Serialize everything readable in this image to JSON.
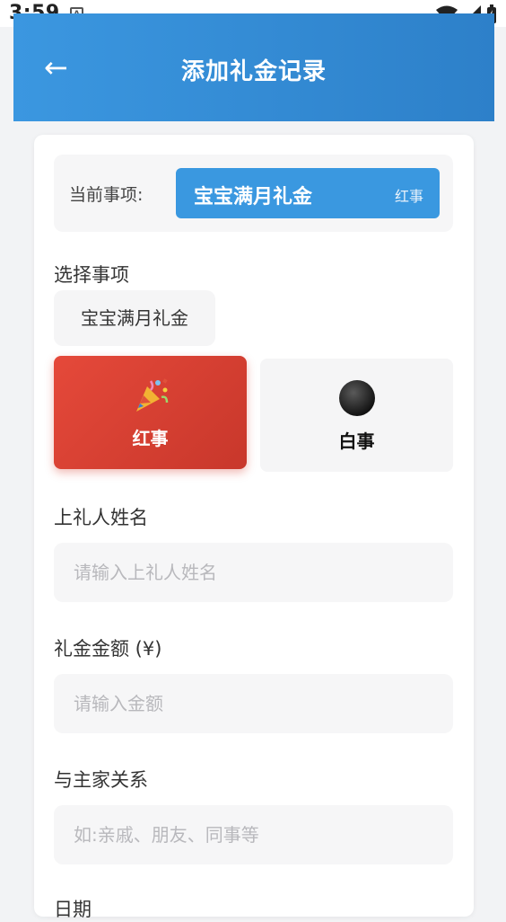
{
  "status": {
    "time": "3:59",
    "notif_icon": "A"
  },
  "header": {
    "back_icon": "←",
    "title": "添加礼金记录"
  },
  "current": {
    "label": "当前事项:",
    "name": "宝宝满月礼金",
    "tag": "红事"
  },
  "select_event": {
    "label": "选择事项",
    "chip": "宝宝满月礼金"
  },
  "types": [
    {
      "label": "红事",
      "icon": "party-popper-icon",
      "selected": true
    },
    {
      "label": "白事",
      "icon": "black-circle-icon",
      "selected": false
    }
  ],
  "fields": {
    "giver": {
      "label": "上礼人姓名",
      "placeholder": "请输入上礼人姓名"
    },
    "amount": {
      "label": "礼金金额 (¥)",
      "placeholder": "请输入金额"
    },
    "relation": {
      "label": "与主家关系",
      "placeholder": "如:亲戚、朋友、同事等"
    },
    "date": {
      "label": "日期"
    }
  },
  "colors": {
    "primary": "#3a98e0",
    "red": "#d63c2d"
  }
}
